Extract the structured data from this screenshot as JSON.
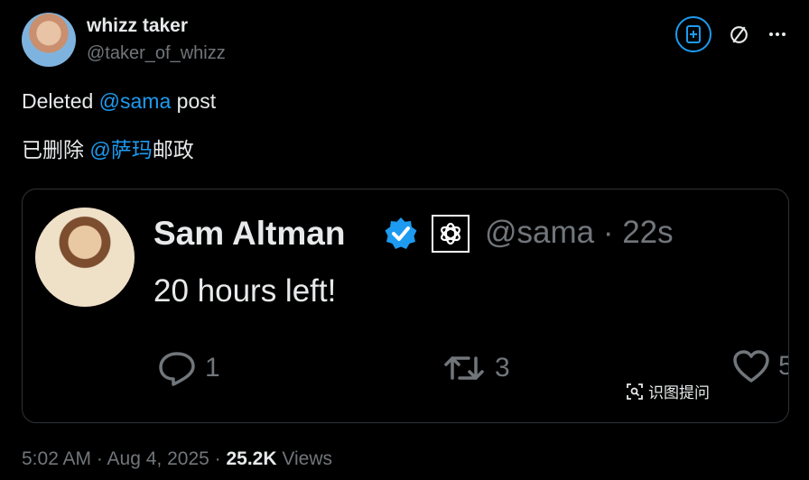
{
  "author": {
    "name": "whizz taker",
    "handle": "@taker_of_whizz"
  },
  "icons": {
    "grok": "grok-plus-icon",
    "circle_slash": "circle-slash-icon",
    "more": "more-icon"
  },
  "post": {
    "line1": {
      "before": "Deleted ",
      "mention": "@sama",
      "after": " post"
    },
    "line2": {
      "before": "已删除 ",
      "mention": "@萨玛",
      "after": "邮政"
    }
  },
  "quote": {
    "name": "Sam Altman",
    "handle_time": "@sama · 22s",
    "text": "20 hours left!",
    "replies": "1",
    "retweets": "3",
    "likes": "5",
    "ocr_label": "识图提问"
  },
  "meta": {
    "time_date": "5:02 AM · Aug 4, 2025 · ",
    "views_count": "25.2K",
    "views_label": " Views"
  },
  "colors": {
    "accent": "#1d9bf0",
    "muted": "#71767b",
    "text": "#e7e9ea",
    "background": "#000000"
  }
}
